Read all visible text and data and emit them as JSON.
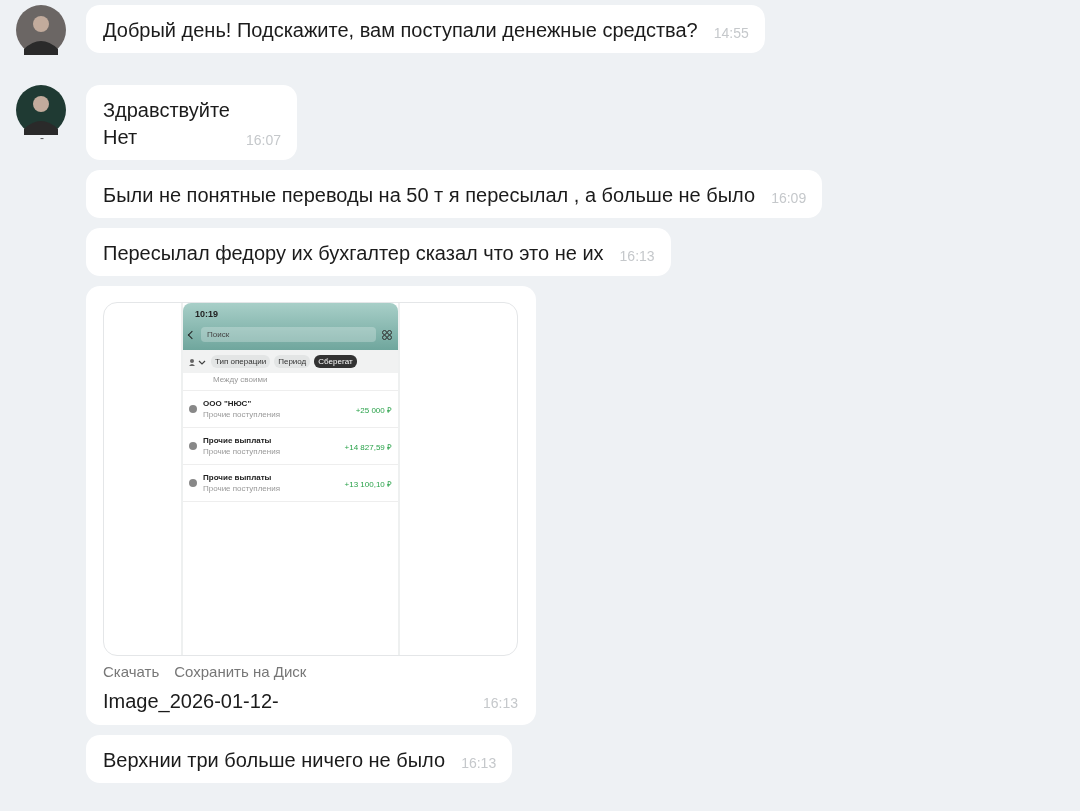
{
  "messages": [
    {
      "kind": "text",
      "avatar": {
        "color": "#6b6664"
      },
      "lines": [
        "Добрый день! Подскажите, вам поступали денежные средства?"
      ],
      "time": "14:55"
    },
    {
      "kind": "text",
      "avatar": {
        "color": "#1f3a33"
      },
      "sender_mark": "-",
      "lines": [
        "Здравствуйте",
        "Нет"
      ],
      "time": "16:07"
    },
    {
      "kind": "text",
      "lines": [
        "Были не понятные переводы на 50 т я пересылал , а больше не было"
      ],
      "time": "16:09"
    },
    {
      "kind": "text",
      "lines": [
        "Пересылал федору их бухгалтер сказал что это не их"
      ],
      "time": "16:13"
    },
    {
      "kind": "image",
      "actions": [
        "Скачать",
        "Сохранить на Диск"
      ],
      "filename": "Image_2026-01-12-",
      "time": "16:13",
      "phone": {
        "clock": "10:19",
        "search_placeholder": "Поиск",
        "filters": [
          "Тип операции",
          "Период",
          "Сберегат"
        ],
        "top_note": "Между своими",
        "operations": [
          {
            "title": "ООО \"НЮС\"",
            "subtitle": "Прочие поступления",
            "amount": "+25 000 ₽"
          },
          {
            "title": "Прочие выплаты",
            "subtitle": "Прочие поступления",
            "amount": "+14 827,59 ₽"
          },
          {
            "title": "Прочие выплаты",
            "subtitle": "Прочие поступления",
            "amount": "+13 100,10 ₽"
          }
        ]
      }
    },
    {
      "kind": "text",
      "lines": [
        "Верхнии три больше ничего не было"
      ],
      "time": "16:13"
    }
  ]
}
